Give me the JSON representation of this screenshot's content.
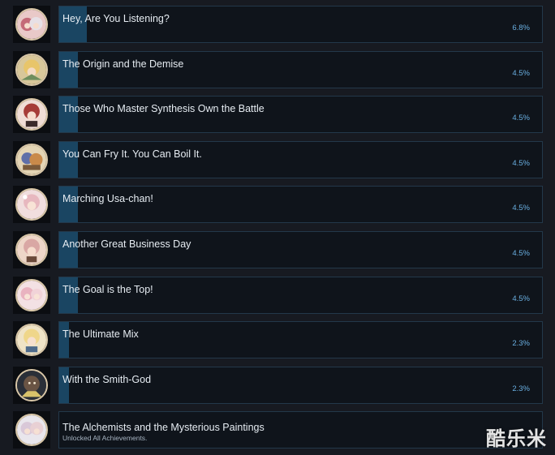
{
  "achievements": [
    {
      "title": "Hey, Are You Listening?",
      "percent": "6.8%",
      "portrait": "twin-girls-portrait-icon"
    },
    {
      "title": "The Origin and the Demise",
      "percent": "4.5%",
      "portrait": "blonde-girl-portrait-icon"
    },
    {
      "title": "Those Who Master Synthesis Own the Battle",
      "percent": "4.5%",
      "portrait": "red-hair-girl-portrait-icon"
    },
    {
      "title": "You Can Fry It. You Can Boil It.",
      "percent": "4.5%",
      "portrait": "pot-creature-portrait-icon"
    },
    {
      "title": "Marching Usa-chan!",
      "percent": "4.5%",
      "portrait": "pink-girl-portrait-icon"
    },
    {
      "title": "Another Great Business Day",
      "percent": "4.5%",
      "portrait": "merchant-girl-portrait-icon"
    },
    {
      "title": "The Goal is the Top!",
      "percent": "4.5%",
      "portrait": "pink-duo-portrait-icon"
    },
    {
      "title": "The Ultimate Mix",
      "percent": "2.3%",
      "portrait": "blonde-alchemist-portrait-icon"
    },
    {
      "title": "With the Smith-God",
      "percent": "2.3%",
      "portrait": "smith-god-portrait-icon"
    },
    {
      "title": "The Alchemists and the Mysterious Paintings",
      "subtitle": "Unlocked All Achievements.",
      "percent": "",
      "portrait": "alchemists-duo-portrait-icon"
    }
  ],
  "colors": {
    "background": "#171a21",
    "row_bg": "#0f141b",
    "fill": "#1a4562",
    "percent_text": "#69aee0"
  },
  "watermark": "酷乐米"
}
